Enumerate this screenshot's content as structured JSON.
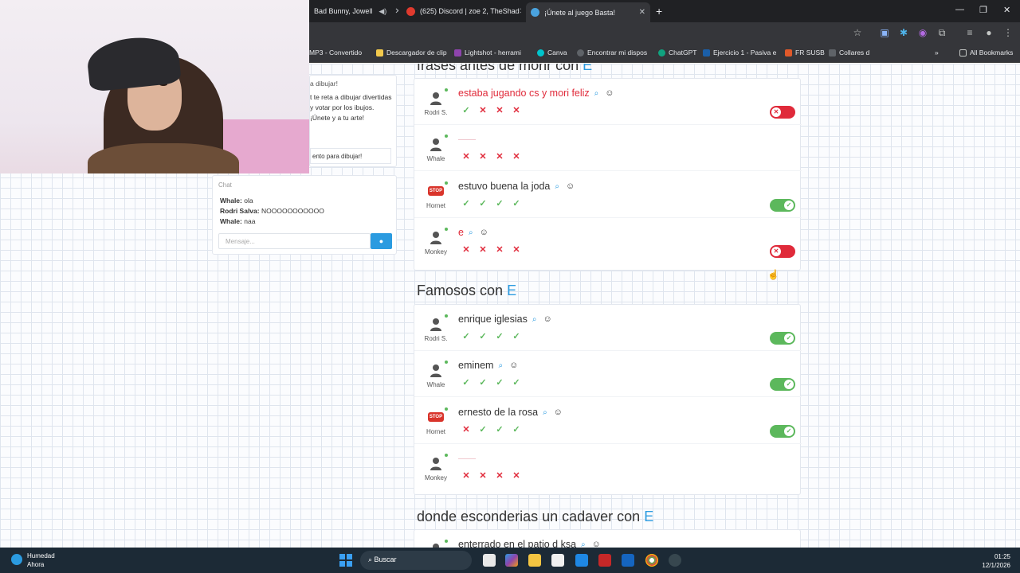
{
  "browser": {
    "tabs": [
      {
        "label": "Bad Bunny, Jowell",
        "active": false
      },
      {
        "label": "(625) Discord | zoe 2, TheShad",
        "active": false
      },
      {
        "label": "¡Únete al juego Basta!",
        "active": true
      }
    ],
    "bookmarks": [
      "MP3 - Convertido",
      "Descargador de clip",
      "Lightshot - herrami",
      "Canva",
      "Encontrar mi dispos",
      "ChatGPT",
      "Ejercicio 1 - Pasiva e",
      "FR SUSB",
      "Collares d",
      "All Bookmarks"
    ]
  },
  "invite": {
    "title": "a dibujar!",
    "text": "t te reta a dibujar divertidas y votar por los ibujos. ¡Únete y a tu arte!",
    "button": "ento para dibujar!"
  },
  "chat": {
    "title": "Chat",
    "messages": [
      {
        "user": "Whale:",
        "text": "ola"
      },
      {
        "user": "Rodri Salva:",
        "text": "NOOOOOOOOOOO"
      },
      {
        "user": "Whale:",
        "text": "naa"
      }
    ],
    "placeholder": "Mensaje..."
  },
  "sections": [
    {
      "title": "frases antes de morir con",
      "letter": "E",
      "rows": [
        {
          "player": "Rodri S.",
          "avatar": "person",
          "answer": "estaba jugando cs y mori feliz",
          "valid": false,
          "votes": [
            "ok",
            "no",
            "no",
            "no"
          ],
          "toggle": "off"
        },
        {
          "player": "Whale",
          "avatar": "person",
          "answer": "",
          "valid": false,
          "votes": [
            "no",
            "no",
            "no",
            "no"
          ],
          "toggle": "none"
        },
        {
          "player": "Hornet",
          "avatar": "stop",
          "answer": "estuvo buena la joda",
          "valid": true,
          "votes": [
            "ok",
            "ok",
            "ok",
            "ok"
          ],
          "toggle": "on"
        },
        {
          "player": "Monkey",
          "avatar": "person",
          "answer": "e",
          "valid": false,
          "votes": [
            "no",
            "no",
            "no",
            "no"
          ],
          "toggle": "off"
        }
      ]
    },
    {
      "title": "Famosos con",
      "letter": "E",
      "rows": [
        {
          "player": "Rodri S.",
          "avatar": "person",
          "answer": "enrique iglesias",
          "valid": true,
          "votes": [
            "ok",
            "ok",
            "ok",
            "ok"
          ],
          "toggle": "on"
        },
        {
          "player": "Whale",
          "avatar": "person",
          "answer": "eminem",
          "valid": true,
          "votes": [
            "ok",
            "ok",
            "ok",
            "ok"
          ],
          "toggle": "on"
        },
        {
          "player": "Hornet",
          "avatar": "stop",
          "answer": "ernesto de la rosa",
          "valid": true,
          "votes": [
            "no",
            "ok",
            "ok",
            "ok"
          ],
          "toggle": "on"
        },
        {
          "player": "Monkey",
          "avatar": "person",
          "answer": "",
          "valid": false,
          "votes": [
            "no",
            "no",
            "no",
            "no"
          ],
          "toggle": "none"
        }
      ]
    },
    {
      "title": "donde esconderias un cadaver con",
      "letter": "E",
      "rows": [
        {
          "player": "",
          "avatar": "person",
          "answer": "enterrado en el patio d ksa",
          "valid": true,
          "votes": [],
          "toggle": "none"
        }
      ]
    }
  ],
  "taskbar": {
    "weather_title": "Humedad",
    "weather_sub": "Ahora",
    "search": "Buscar",
    "time": "01:25",
    "date": "12/1/2026"
  },
  "colors": {
    "accent": "#2b9be0",
    "ok": "#5cb85c",
    "wrong": "#e02a3a"
  }
}
